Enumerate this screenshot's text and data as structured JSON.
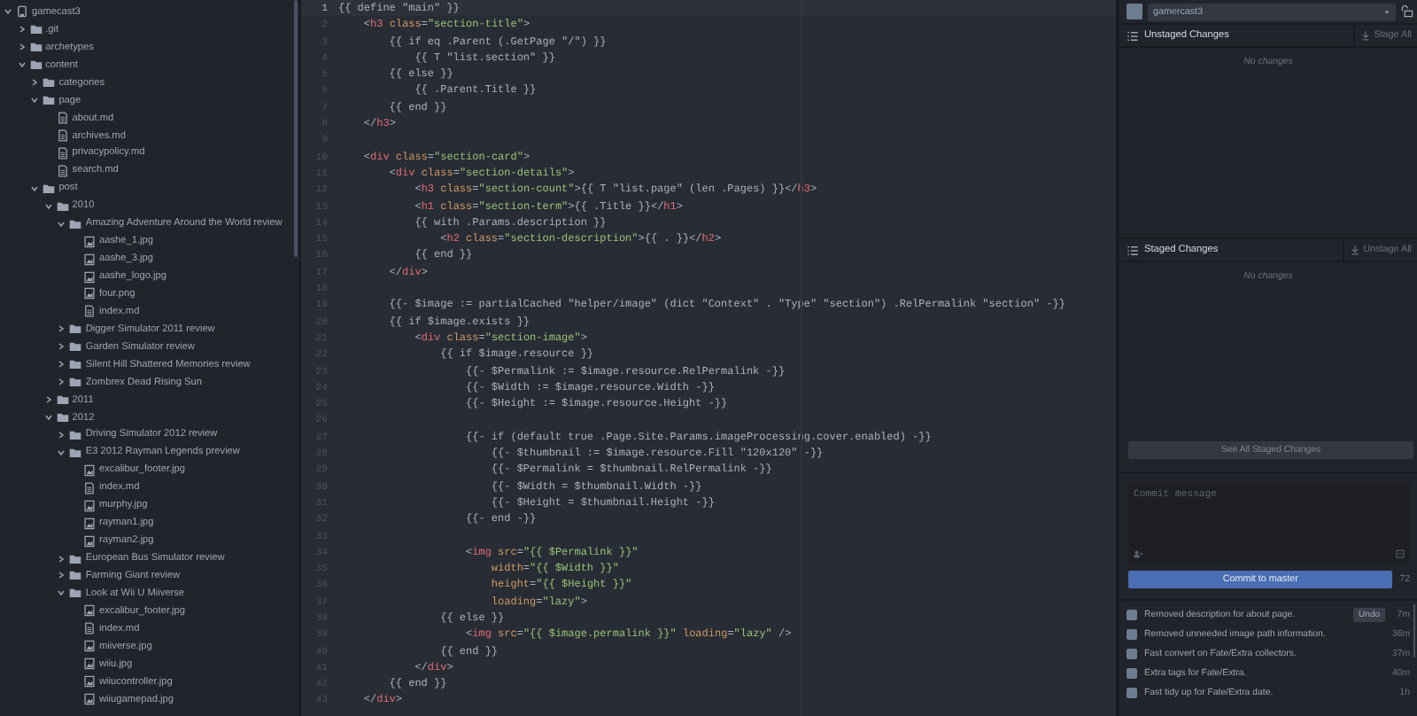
{
  "file_tree": {
    "root": {
      "name": "gamecast3",
      "kind": "repo",
      "expanded": true,
      "children": [
        {
          "name": ".git",
          "kind": "folder",
          "expanded": false
        },
        {
          "name": "archetypes",
          "kind": "folder",
          "expanded": false
        },
        {
          "name": "content",
          "kind": "folder",
          "expanded": true,
          "children": [
            {
              "name": "categories",
              "kind": "folder",
              "expanded": false
            },
            {
              "name": "page",
              "kind": "folder",
              "expanded": true,
              "children": [
                {
                  "name": "about.md",
                  "kind": "file"
                },
                {
                  "name": "archives.md",
                  "kind": "file"
                },
                {
                  "name": "privacypolicy.md",
                  "kind": "file"
                },
                {
                  "name": "search.md",
                  "kind": "file"
                }
              ]
            },
            {
              "name": "post",
              "kind": "folder",
              "expanded": true,
              "children": [
                {
                  "name": "2010",
                  "kind": "folder",
                  "expanded": true,
                  "children": [
                    {
                      "name": "Amazing Adventure Around the World review",
                      "kind": "folder",
                      "expanded": true,
                      "children": [
                        {
                          "name": "aashe_1.jpg",
                          "kind": "image"
                        },
                        {
                          "name": "aashe_3.jpg",
                          "kind": "image"
                        },
                        {
                          "name": "aashe_logo.jpg",
                          "kind": "image"
                        },
                        {
                          "name": "four.png",
                          "kind": "image"
                        },
                        {
                          "name": "index.md",
                          "kind": "file"
                        }
                      ]
                    },
                    {
                      "name": "Digger Simulator 2011 review",
                      "kind": "folder",
                      "expanded": false
                    },
                    {
                      "name": "Garden Simulator review",
                      "kind": "folder",
                      "expanded": false
                    },
                    {
                      "name": "Silent Hill Shattered Memories review",
                      "kind": "folder",
                      "expanded": false
                    },
                    {
                      "name": "Zombrex Dead Rising Sun",
                      "kind": "folder",
                      "expanded": false
                    }
                  ]
                },
                {
                  "name": "2011",
                  "kind": "folder",
                  "expanded": false
                },
                {
                  "name": "2012",
                  "kind": "folder",
                  "expanded": true,
                  "children": [
                    {
                      "name": "Driving Simulator 2012 review",
                      "kind": "folder",
                      "expanded": false
                    },
                    {
                      "name": "E3 2012 Rayman Legends preview",
                      "kind": "folder",
                      "expanded": true,
                      "children": [
                        {
                          "name": "excalibur_footer.jpg",
                          "kind": "image"
                        },
                        {
                          "name": "index.md",
                          "kind": "file"
                        },
                        {
                          "name": "murphy.jpg",
                          "kind": "image"
                        },
                        {
                          "name": "rayman1.jpg",
                          "kind": "image"
                        },
                        {
                          "name": "rayman2.jpg",
                          "kind": "image"
                        }
                      ]
                    },
                    {
                      "name": "European Bus Simulator review",
                      "kind": "folder",
                      "expanded": false
                    },
                    {
                      "name": "Farming Giant review",
                      "kind": "folder",
                      "expanded": false
                    },
                    {
                      "name": "Look at Wii U Miiverse",
                      "kind": "folder",
                      "expanded": true,
                      "children": [
                        {
                          "name": "excalibur_footer.jpg",
                          "kind": "image"
                        },
                        {
                          "name": "index.md",
                          "kind": "file"
                        },
                        {
                          "name": "miiverse.jpg",
                          "kind": "image"
                        },
                        {
                          "name": "wiiu.jpg",
                          "kind": "image"
                        },
                        {
                          "name": "wiiucontroller.jpg",
                          "kind": "image"
                        },
                        {
                          "name": "wiiugamepad.jpg",
                          "kind": "image"
                        }
                      ]
                    }
                  ]
                }
              ]
            }
          ]
        }
      ]
    }
  },
  "editor": {
    "lines": [
      {
        "number": "1",
        "current": true,
        "tokens": [
          {
            "kind": "plain",
            "text": "{{ define \"main\" }}"
          }
        ]
      },
      {
        "number": "2",
        "current": false,
        "tokens": [
          {
            "kind": "plain",
            "text": "    <"
          },
          {
            "kind": "tag",
            "text": "h3"
          },
          {
            "kind": "attr",
            "text": " class"
          },
          {
            "kind": "plain",
            "text": "="
          },
          {
            "kind": "str",
            "text": "\"section-title\""
          },
          {
            "kind": "plain",
            "text": ">"
          }
        ]
      },
      {
        "number": "3",
        "current": false,
        "tokens": [
          {
            "kind": "plain",
            "text": "        {{ if eq .Parent (.GetPage \"/\") }}"
          }
        ]
      },
      {
        "number": "4",
        "current": false,
        "tokens": [
          {
            "kind": "plain",
            "text": "            {{ T \"list.section\" }}"
          }
        ]
      },
      {
        "number": "5",
        "current": false,
        "tokens": [
          {
            "kind": "plain",
            "text": "        {{ else }}"
          }
        ]
      },
      {
        "number": "6",
        "current": false,
        "tokens": [
          {
            "kind": "plain",
            "text": "            {{ .Parent.Title }}"
          }
        ]
      },
      {
        "number": "7",
        "current": false,
        "tokens": [
          {
            "kind": "plain",
            "text": "        {{ end }}"
          }
        ]
      },
      {
        "number": "8",
        "current": false,
        "tokens": [
          {
            "kind": "plain",
            "text": "    </"
          },
          {
            "kind": "tag",
            "text": "h3"
          },
          {
            "kind": "plain",
            "text": ">"
          }
        ]
      },
      {
        "number": "9",
        "current": false
      },
      {
        "number": "10",
        "current": false,
        "tokens": [
          {
            "kind": "plain",
            "text": "    <"
          },
          {
            "kind": "tag",
            "text": "div"
          },
          {
            "kind": "attr",
            "text": " class"
          },
          {
            "kind": "plain",
            "text": "="
          },
          {
            "kind": "str",
            "text": "\"section-card\""
          },
          {
            "kind": "plain",
            "text": ">"
          }
        ]
      },
      {
        "number": "11",
        "current": false,
        "tokens": [
          {
            "kind": "plain",
            "text": "        <"
          },
          {
            "kind": "tag",
            "text": "div"
          },
          {
            "kind": "attr",
            "text": " class"
          },
          {
            "kind": "plain",
            "text": "="
          },
          {
            "kind": "str",
            "text": "\"section-details\""
          },
          {
            "kind": "plain",
            "text": ">"
          }
        ]
      },
      {
        "number": "12",
        "current": false,
        "tokens": [
          {
            "kind": "plain",
            "text": "            <"
          },
          {
            "kind": "tag",
            "text": "h3"
          },
          {
            "kind": "attr",
            "text": " class"
          },
          {
            "kind": "plain",
            "text": "="
          },
          {
            "kind": "str",
            "text": "\"section-count\""
          },
          {
            "kind": "plain",
            "text": ">{{ T \"list.page\" (len .Pages) }}</"
          },
          {
            "kind": "tag",
            "text": "h3"
          },
          {
            "kind": "plain",
            "text": ">"
          }
        ]
      },
      {
        "number": "13",
        "current": false,
        "tokens": [
          {
            "kind": "plain",
            "text": "            <"
          },
          {
            "kind": "tag",
            "text": "h1"
          },
          {
            "kind": "attr",
            "text": " class"
          },
          {
            "kind": "plain",
            "text": "="
          },
          {
            "kind": "str",
            "text": "\"section-term\""
          },
          {
            "kind": "plain",
            "text": ">{{ .Title }}</"
          },
          {
            "kind": "tag",
            "text": "h1"
          },
          {
            "kind": "plain",
            "text": ">"
          }
        ]
      },
      {
        "number": "14",
        "current": false,
        "tokens": [
          {
            "kind": "plain",
            "text": "            {{ with .Params.description }}"
          }
        ]
      },
      {
        "number": "15",
        "current": false,
        "tokens": [
          {
            "kind": "plain",
            "text": "                <"
          },
          {
            "kind": "tag",
            "text": "h2"
          },
          {
            "kind": "attr",
            "text": " class"
          },
          {
            "kind": "plain",
            "text": "="
          },
          {
            "kind": "str",
            "text": "\"section-description\""
          },
          {
            "kind": "plain",
            "text": ">{{ . }}</"
          },
          {
            "kind": "tag",
            "text": "h2"
          },
          {
            "kind": "plain",
            "text": ">"
          }
        ]
      },
      {
        "number": "16",
        "current": false,
        "tokens": [
          {
            "kind": "plain",
            "text": "            {{ end }}"
          }
        ]
      },
      {
        "number": "17",
        "current": false,
        "tokens": [
          {
            "kind": "plain",
            "text": "        </"
          },
          {
            "kind": "tag",
            "text": "div"
          },
          {
            "kind": "plain",
            "text": ">"
          }
        ]
      },
      {
        "number": "18",
        "current": false
      },
      {
        "number": "19",
        "current": false,
        "tokens": [
          {
            "kind": "plain",
            "text": "        {{- $image := partialCached \"helper/image\" (dict \"Context\" . \"Type\" \"section\") .RelPermalink \"section\" -}}"
          }
        ]
      },
      {
        "number": "20",
        "current": false,
        "tokens": [
          {
            "kind": "plain",
            "text": "        {{ if $image.exists }}"
          }
        ]
      },
      {
        "number": "21",
        "current": false,
        "tokens": [
          {
            "kind": "plain",
            "text": "            <"
          },
          {
            "kind": "tag",
            "text": "div"
          },
          {
            "kind": "attr",
            "text": " class"
          },
          {
            "kind": "plain",
            "text": "="
          },
          {
            "kind": "str",
            "text": "\"section-image\""
          },
          {
            "kind": "plain",
            "text": ">"
          }
        ]
      },
      {
        "number": "22",
        "current": false,
        "tokens": [
          {
            "kind": "plain",
            "text": "                {{ if $image.resource }}"
          }
        ]
      },
      {
        "number": "23",
        "current": false,
        "tokens": [
          {
            "kind": "plain",
            "text": "                    {{- $Permalink := $image.resource.RelPermalink -}}"
          }
        ]
      },
      {
        "number": "24",
        "current": false,
        "tokens": [
          {
            "kind": "plain",
            "text": "                    {{- $Width := $image.resource.Width -}}"
          }
        ]
      },
      {
        "number": "25",
        "current": false,
        "tokens": [
          {
            "kind": "plain",
            "text": "                    {{- $Height := $image.resource.Height -}}"
          }
        ]
      },
      {
        "number": "26",
        "current": false
      },
      {
        "number": "27",
        "current": false,
        "tokens": [
          {
            "kind": "plain",
            "text": "                    {{- if (default true .Page.Site.Params.imageProcessing.cover.enabled) -}}"
          }
        ]
      },
      {
        "number": "28",
        "current": false,
        "tokens": [
          {
            "kind": "plain",
            "text": "                        {{- $thumbnail := $image.resource.Fill \"120x120\" -}}"
          }
        ]
      },
      {
        "number": "29",
        "current": false,
        "tokens": [
          {
            "kind": "plain",
            "text": "                        {{- $Permalink = $thumbnail.RelPermalink -}}"
          }
        ]
      },
      {
        "number": "30",
        "current": false,
        "tokens": [
          {
            "kind": "plain",
            "text": "                        {{- $Width = $thumbnail.Width -}}"
          }
        ]
      },
      {
        "number": "31",
        "current": false,
        "tokens": [
          {
            "kind": "plain",
            "text": "                        {{- $Height = $thumbnail.Height -}}"
          }
        ]
      },
      {
        "number": "32",
        "current": false,
        "tokens": [
          {
            "kind": "plain",
            "text": "                    {{- end -}}"
          }
        ]
      },
      {
        "number": "33",
        "current": false
      },
      {
        "number": "34",
        "current": false,
        "tokens": [
          {
            "kind": "plain",
            "text": "                    <"
          },
          {
            "kind": "tag",
            "text": "img"
          },
          {
            "kind": "attr",
            "text": " src"
          },
          {
            "kind": "plain",
            "text": "="
          },
          {
            "kind": "str",
            "text": "\"{{ $Permalink }}\""
          }
        ]
      },
      {
        "number": "35",
        "current": false,
        "tokens": [
          {
            "kind": "attr",
            "text": "                        width"
          },
          {
            "kind": "plain",
            "text": "="
          },
          {
            "kind": "str",
            "text": "\"{{ $Width }}\""
          }
        ]
      },
      {
        "number": "36",
        "current": false,
        "tokens": [
          {
            "kind": "attr",
            "text": "                        height"
          },
          {
            "kind": "plain",
            "text": "="
          },
          {
            "kind": "str",
            "text": "\"{{ $Height }}\""
          }
        ]
      },
      {
        "number": "37",
        "current": false,
        "tokens": [
          {
            "kind": "attr",
            "text": "                        loading"
          },
          {
            "kind": "plain",
            "text": "="
          },
          {
            "kind": "str",
            "text": "\"lazy\""
          },
          {
            "kind": "plain",
            "text": ">"
          }
        ]
      },
      {
        "number": "38",
        "current": false,
        "tokens": [
          {
            "kind": "plain",
            "text": "                {{ else }}"
          }
        ]
      },
      {
        "number": "39",
        "current": false,
        "tokens": [
          {
            "kind": "plain",
            "text": "                    <"
          },
          {
            "kind": "tag",
            "text": "img"
          },
          {
            "kind": "attr",
            "text": " src"
          },
          {
            "kind": "plain",
            "text": "="
          },
          {
            "kind": "str",
            "text": "\"{{ $image.permalink }}\""
          },
          {
            "kind": "attr",
            "text": " loading"
          },
          {
            "kind": "plain",
            "text": "="
          },
          {
            "kind": "str",
            "text": "\"lazy\""
          },
          {
            "kind": "plain",
            "text": " />"
          }
        ]
      },
      {
        "number": "40",
        "current": false,
        "tokens": [
          {
            "kind": "plain",
            "text": "                {{ end }}"
          }
        ]
      },
      {
        "number": "41",
        "current": false,
        "tokens": [
          {
            "kind": "plain",
            "text": "            </"
          },
          {
            "kind": "tag",
            "text": "div"
          },
          {
            "kind": "plain",
            "text": ">"
          }
        ]
      },
      {
        "number": "42",
        "current": false,
        "tokens": [
          {
            "kind": "plain",
            "text": "        {{ end }}"
          }
        ]
      },
      {
        "number": "43",
        "current": false,
        "tokens": [
          {
            "kind": "plain",
            "text": "    </"
          },
          {
            "kind": "tag",
            "text": "div"
          },
          {
            "kind": "plain",
            "text": ">"
          }
        ]
      }
    ]
  },
  "git_panel": {
    "repository": "gamercast3",
    "unstaged": {
      "title": "Unstaged Changes",
      "action": "Stage All",
      "empty": "No changes"
    },
    "staged": {
      "title": "Staged Changes",
      "action": "Unstage All",
      "empty": "No changes"
    },
    "see_all": "See All Staged Changes",
    "commit_message": {
      "placeholder": "Commit message"
    },
    "remaining": "72",
    "commit_button": "Commit to master",
    "commits": [
      {
        "message": "Removed description for about page.",
        "action": "Undo",
        "time": "7m"
      },
      {
        "message": "Removed unneeded image path information.",
        "time": "36m"
      },
      {
        "message": "Fast convert on Fate/Extra collectors.",
        "time": "37m"
      },
      {
        "message": "Extra tags for Fate/Extra.",
        "time": "40m"
      },
      {
        "message": "Fast tidy up for Fate/Extra date.",
        "time": "1h"
      }
    ]
  }
}
